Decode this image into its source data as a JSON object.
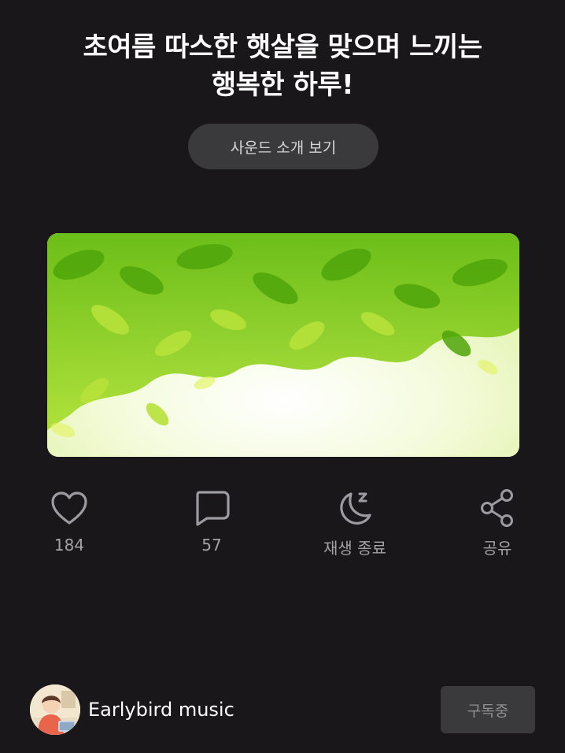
{
  "header": {
    "title_line1": "초여름 따스한 햇살을 맞으며 느끼는",
    "title_line2": "행복한 하루!"
  },
  "intro_button": {
    "label": "사운드 소개 보기"
  },
  "actions": {
    "like": {
      "icon": "heart-icon",
      "count": "184"
    },
    "comment": {
      "icon": "comment-icon",
      "count": "57"
    },
    "sleep_timer": {
      "icon": "moon-zzz-icon",
      "label": "재생 종료"
    },
    "share": {
      "icon": "share-icon",
      "label": "공유"
    }
  },
  "channel": {
    "name": "Earlybird music",
    "subscribe_label": "구독중"
  },
  "colors": {
    "background": "#19171a",
    "button_bg": "#3a393c",
    "icon_gray": "#9c9ca0",
    "leaf_green": "#7ccb12"
  }
}
